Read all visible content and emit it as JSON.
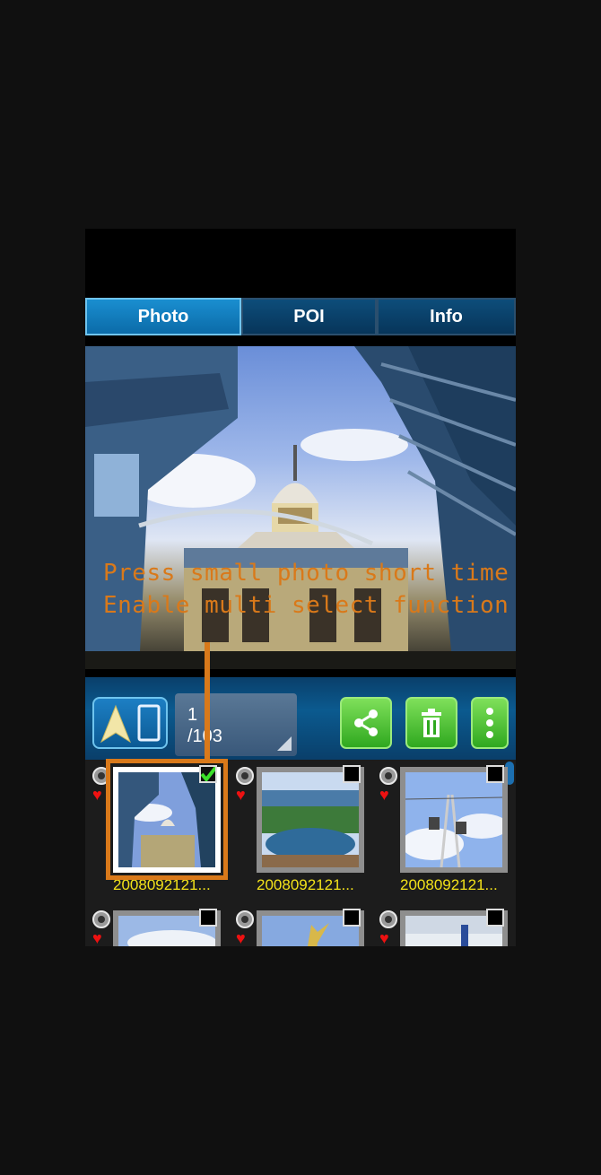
{
  "tabs": [
    {
      "label": "Photo",
      "active": true
    },
    {
      "label": "POI",
      "active": false
    },
    {
      "label": "Info",
      "active": false
    }
  ],
  "overlay": {
    "line1": "Press small photo short time",
    "line2": "Enable multi select function",
    "color": "#d9791a"
  },
  "toolbar": {
    "counter_current": "1",
    "counter_total": "/103",
    "buttons": [
      "navigate-compass-icon",
      "share-icon",
      "trash-icon",
      "more-vertical-icon"
    ]
  },
  "gallery": {
    "items": [
      {
        "name": "2008092121...",
        "checked": true
      },
      {
        "name": "2008092121...",
        "checked": false
      },
      {
        "name": "2008092121...",
        "checked": false
      },
      {
        "name": "",
        "checked": false
      },
      {
        "name": "",
        "checked": false
      },
      {
        "name": "",
        "checked": false
      }
    ]
  },
  "colors": {
    "accent_green": "#3cb52a",
    "tab_active": "#1a8ed0",
    "filename": "#f2e11a",
    "highlight": "#d9791a"
  }
}
